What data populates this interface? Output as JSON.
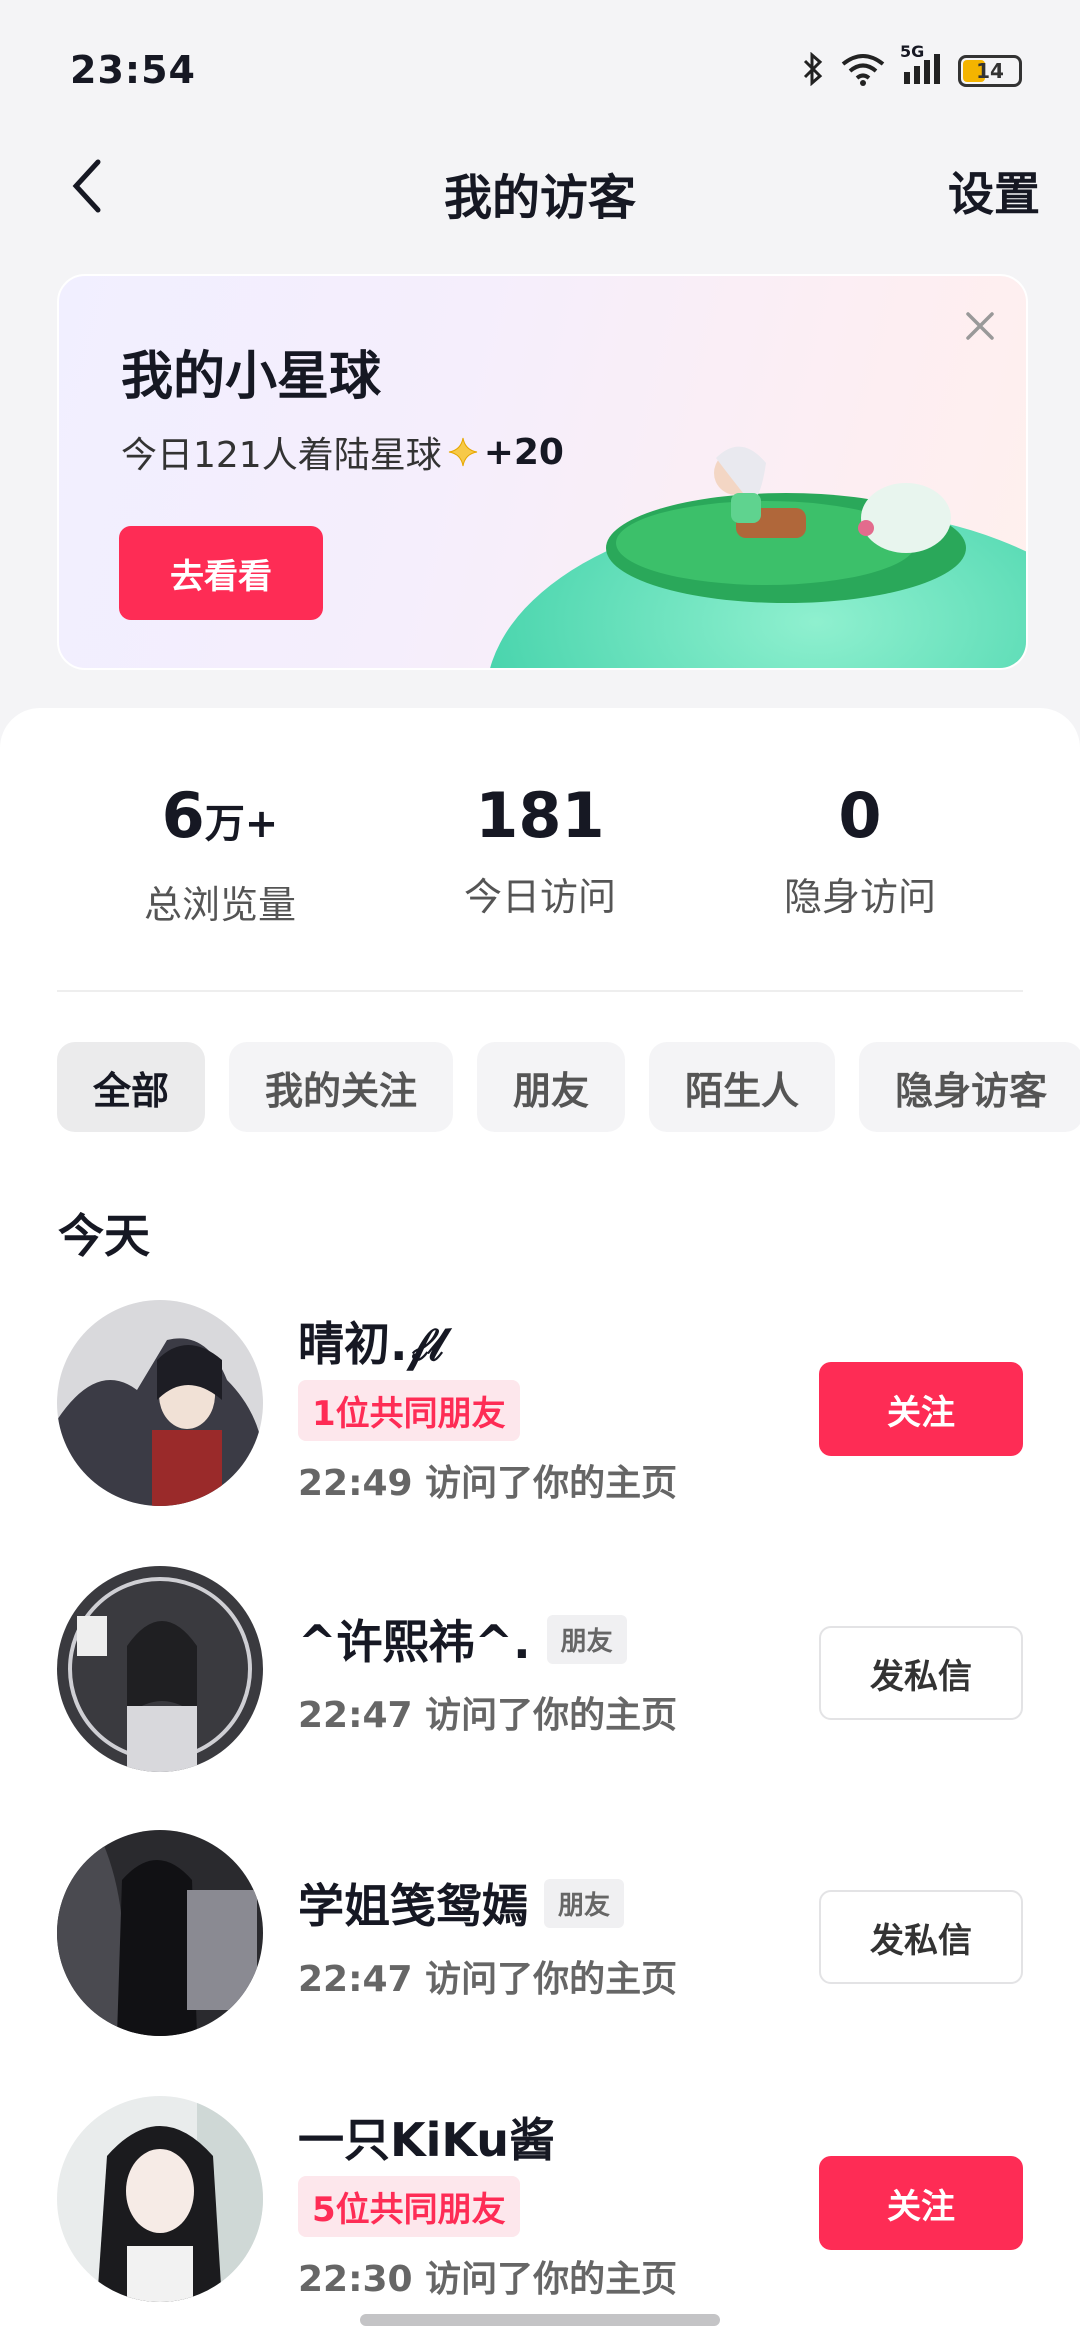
{
  "status_bar": {
    "time": "23:54",
    "network": "5G",
    "battery": "14"
  },
  "nav": {
    "title": "我的访客",
    "settings_label": "设置"
  },
  "banner": {
    "title": "我的小星球",
    "subtitle_prefix": "今日121人着陆星球",
    "subtitle_bonus": "+20",
    "button_label": "去看看"
  },
  "stats": [
    {
      "value": "6",
      "unit": "万+",
      "label": "总浏览量"
    },
    {
      "value": "181",
      "label": "今日访问"
    },
    {
      "value": "0",
      "label": "隐身访问"
    }
  ],
  "filters": [
    "全部",
    "我的关注",
    "朋友",
    "陌生人",
    "隐身访客"
  ],
  "section_title": "今天",
  "visitors": [
    {
      "name": "晴初.𝒻𝓁",
      "mutual": "1位共同朋友",
      "visit": "22:49 访问了你的主页",
      "action": "关注"
    },
    {
      "name": "^许熙祎^.",
      "friend_tag": "朋友",
      "visit": "22:47 访问了你的主页",
      "action": "发私信"
    },
    {
      "name": "学姐笺鸳嫣",
      "friend_tag": "朋友",
      "visit": "22:47 访问了你的主页",
      "action": "发私信"
    },
    {
      "name": "一只KiKu酱",
      "mutual": "5位共同朋友",
      "visit": "22:30 访问了你的主页",
      "action": "关注"
    }
  ],
  "colors": {
    "accent": "#fe2c55",
    "text": "#161823",
    "muted": "#666666"
  }
}
